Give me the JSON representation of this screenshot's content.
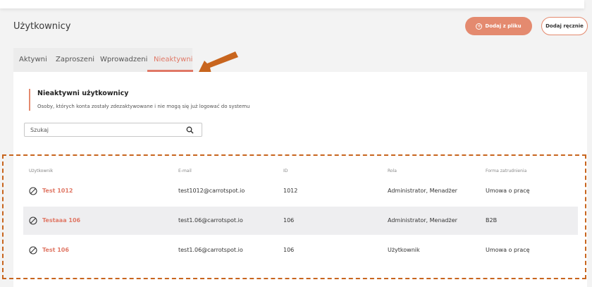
{
  "page": {
    "title": "Użytkownicy"
  },
  "actions": {
    "import_label": "Dodaj z pliku",
    "manual_label": "Dodaj ręcznie"
  },
  "tabs": [
    {
      "label": "Aktywni",
      "active": false
    },
    {
      "label": "Zaproszeni",
      "active": false
    },
    {
      "label": "Wprowadzeni",
      "active": false
    },
    {
      "label": "Nieaktywni",
      "active": true
    }
  ],
  "section": {
    "title": "Nieaktywni użytkownicy",
    "description": "Osoby, których konta zostały zdezaktywowane i nie mogą się już logować do systemu"
  },
  "search": {
    "placeholder": "Szukaj",
    "value": ""
  },
  "table": {
    "headers": [
      "Użytkownik",
      "E-mail",
      "ID",
      "Rola",
      "Forma zatrudnienia"
    ],
    "rows": [
      {
        "name": "Test 1012",
        "email": "test1012@carrotspot.io",
        "id": "1012",
        "role": "Administrator, Menadżer",
        "employment": "Umowa o pracę"
      },
      {
        "name": "Testaaa 106",
        "email": "test1.06@carrotspot.io",
        "id": "106",
        "role": "Administrator, Menadżer",
        "employment": "B2B"
      },
      {
        "name": "Test 106",
        "email": "test1.06@carrotspot.io",
        "id": "106",
        "role": "Użytkownik",
        "employment": "Umowa o pracę"
      }
    ]
  },
  "colors": {
    "accent": "#e07866",
    "button": "#e48a6f",
    "annotation": "#c8651e"
  },
  "icons": {
    "row_status": "ban-icon",
    "search": "search-icon",
    "add": "plus-circle-icon",
    "annotation": "arrow-icon"
  }
}
